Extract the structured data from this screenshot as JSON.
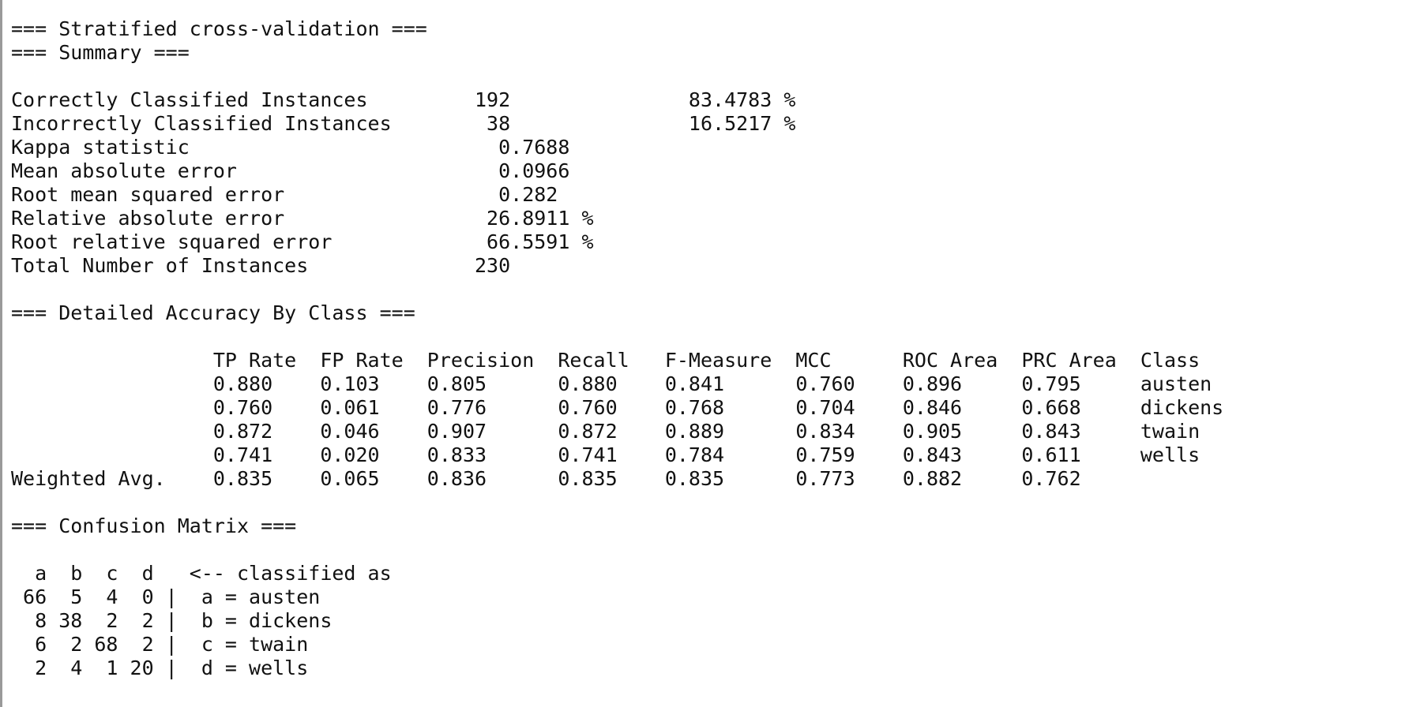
{
  "output": {
    "lines": [
      "=== Stratified cross-validation ===",
      "=== Summary ===",
      "",
      "Correctly Classified Instances         192               83.4783 %",
      "Incorrectly Classified Instances        38               16.5217 %",
      "Kappa statistic                          0.7688",
      "Mean absolute error                      0.0966",
      "Root mean squared error                  0.282",
      "Relative absolute error                 26.8911 %",
      "Root relative squared error             66.5591 %",
      "Total Number of Instances              230",
      "",
      "=== Detailed Accuracy By Class ===",
      "",
      "                 TP Rate  FP Rate  Precision  Recall   F-Measure  MCC      ROC Area  PRC Area  Class",
      "                 0.880    0.103    0.805      0.880    0.841      0.760    0.896     0.795     austen",
      "                 0.760    0.061    0.776      0.760    0.768      0.704    0.846     0.668     dickens",
      "                 0.872    0.046    0.907      0.872    0.889      0.834    0.905     0.843     twain",
      "                 0.741    0.020    0.833      0.741    0.784      0.759    0.843     0.611     wells",
      "Weighted Avg.    0.835    0.065    0.836      0.835    0.835      0.773    0.882     0.762",
      "",
      "=== Confusion Matrix ===",
      "",
      "  a  b  c  d   <-- classified as",
      " 66  5  4  0 |  a = austen",
      "  8 38  2  2 |  b = dickens",
      "  6  2 68  2 |  c = twain",
      "  2  4  1 20 |  d = wells"
    ]
  }
}
